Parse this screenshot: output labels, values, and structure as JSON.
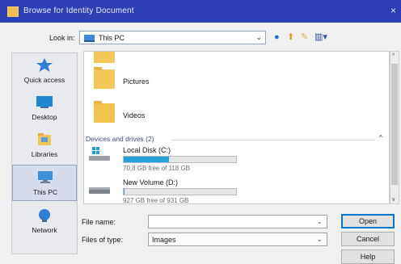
{
  "window": {
    "title": "Browse for Identity Document",
    "close_glyph": "×"
  },
  "lookin": {
    "label": "Look in:",
    "value": "This PC",
    "dropdown_glyph": "⌄"
  },
  "toolbar": {
    "back_glyph": "●",
    "up_glyph": "⬆",
    "newfolder_glyph": "✎",
    "views_glyph": "▥▾"
  },
  "places": [
    {
      "label": "Quick access",
      "icon": "star-icon"
    },
    {
      "label": "Desktop",
      "icon": "desktop-icon"
    },
    {
      "label": "Libraries",
      "icon": "libraries-icon"
    },
    {
      "label": "This PC",
      "icon": "computer-icon",
      "selected": true
    },
    {
      "label": "Network",
      "icon": "network-icon"
    }
  ],
  "files": {
    "folders": [
      {
        "name": "Pictures",
        "icon": "pictures-folder-icon"
      },
      {
        "name": "Videos",
        "icon": "videos-folder-icon"
      }
    ],
    "group": {
      "label": "Devices and drives (2)",
      "chevron": "^"
    },
    "drives": [
      {
        "name": "Local Disk (C:)",
        "free": "70,8 GB free of 118 GB",
        "used_percent": 40,
        "icon": "windows-drive-icon"
      },
      {
        "name": "New Volume (D:)",
        "free": "927 GB free of 931 GB",
        "used_percent": 0.4,
        "icon": "drive-icon"
      }
    ]
  },
  "scrollbar": {
    "up_glyph": "^",
    "down_glyph": "v"
  },
  "form": {
    "filename_label": "File name:",
    "filename_value": "",
    "filetype_label": "Files of type:",
    "filetype_value": "Images",
    "dropdown_glyph": "⌄"
  },
  "buttons": {
    "open": "Open",
    "cancel": "Cancel",
    "help": "Help"
  },
  "colors": {
    "titlebar": "#2c3fb5",
    "progress": "#26a0da",
    "folder": "#f4c95a"
  }
}
